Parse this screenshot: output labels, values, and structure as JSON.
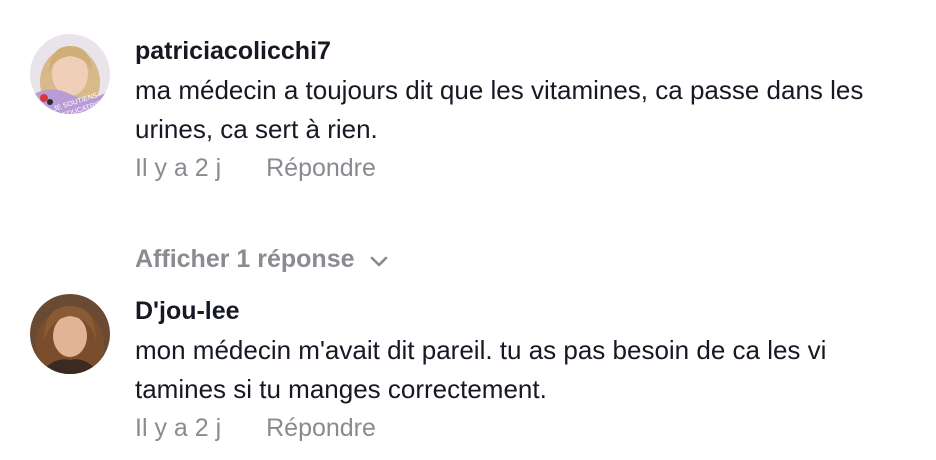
{
  "comments": [
    {
      "username": "patriciacolicchi7",
      "text": "ma médecin a toujours dit que les vitamines, ca passe dans les urines, ca sert à rien.",
      "time": "Il y a 2 j",
      "reply_label": "Répondre",
      "show_replies_label": "Afficher 1 réponse",
      "avatar_badge_text": "JE SOUTIENS LES EDUCATRICES"
    },
    {
      "username": "D'jou-lee",
      "text": "mon médecin m'avait dit pareil. tu as pas besoin de ca les vi tamines si tu manges correctement.",
      "time": "Il y a 2 j",
      "reply_label": "Répondre"
    }
  ],
  "colors": {
    "text_primary": "#161823",
    "text_secondary": "#8a8b91",
    "badge_purple": "#b99bd6"
  },
  "icons": {
    "show_replies": "chevron-down-icon"
  }
}
